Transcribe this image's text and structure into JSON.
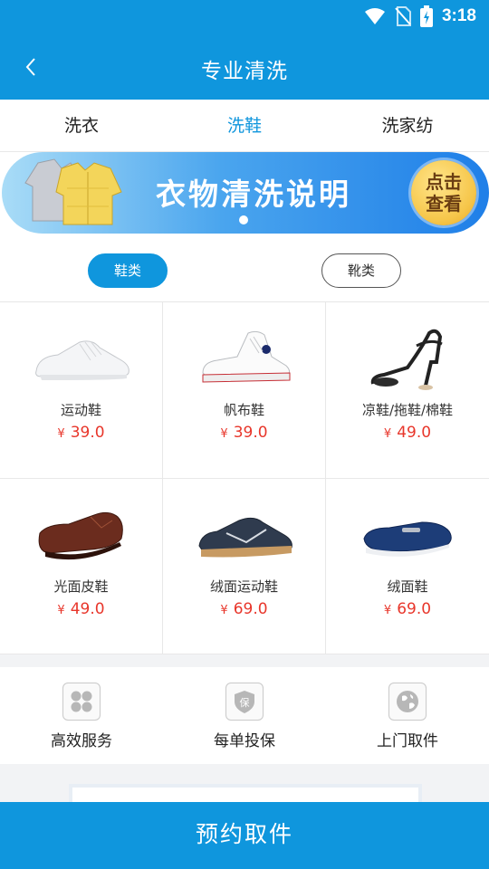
{
  "status_bar": {
    "time": "3:18",
    "icons": [
      "wifi-icon",
      "no-sim-icon",
      "battery-charging-icon"
    ]
  },
  "header": {
    "title": "专业清洗",
    "back_icon": "chevron-left-icon"
  },
  "tabs": [
    {
      "label": "洗衣",
      "active": false
    },
    {
      "label": "洗鞋",
      "active": true
    },
    {
      "label": "洗家纺",
      "active": false
    }
  ],
  "banner": {
    "title": "衣物清洗说明",
    "cta_line1": "点击",
    "cta_line2": "查看",
    "page_indicator": 1
  },
  "filters": [
    {
      "label": "鞋类",
      "active": true
    },
    {
      "label": "靴类",
      "active": false
    }
  ],
  "products": [
    {
      "name": "运动鞋",
      "currency": "¥",
      "price": "39.0",
      "image": "white-sneaker"
    },
    {
      "name": "帆布鞋",
      "currency": "¥",
      "price": "39.0",
      "image": "canvas-high-top"
    },
    {
      "name": "凉鞋/拖鞋/棉鞋",
      "currency": "¥",
      "price": "49.0",
      "image": "black-sandal-heel"
    },
    {
      "name": "光面皮鞋",
      "currency": "¥",
      "price": "49.0",
      "image": "brown-leather-shoe"
    },
    {
      "name": "绒面运动鞋",
      "currency": "¥",
      "price": "69.0",
      "image": "navy-suede-sneaker"
    },
    {
      "name": "绒面鞋",
      "currency": "¥",
      "price": "69.0",
      "image": "navy-suede-loafer"
    }
  ],
  "features": [
    {
      "label": "高效服务",
      "icon": "grid-petals-icon"
    },
    {
      "label": "每单投保",
      "icon": "shield-icon"
    },
    {
      "label": "上门取件",
      "icon": "globe-icon"
    }
  ],
  "bottom_button": {
    "label": "预约取件"
  },
  "colors": {
    "primary": "#0f96dd",
    "price": "#e8362b",
    "cta_gold": "#f6c64a"
  }
}
